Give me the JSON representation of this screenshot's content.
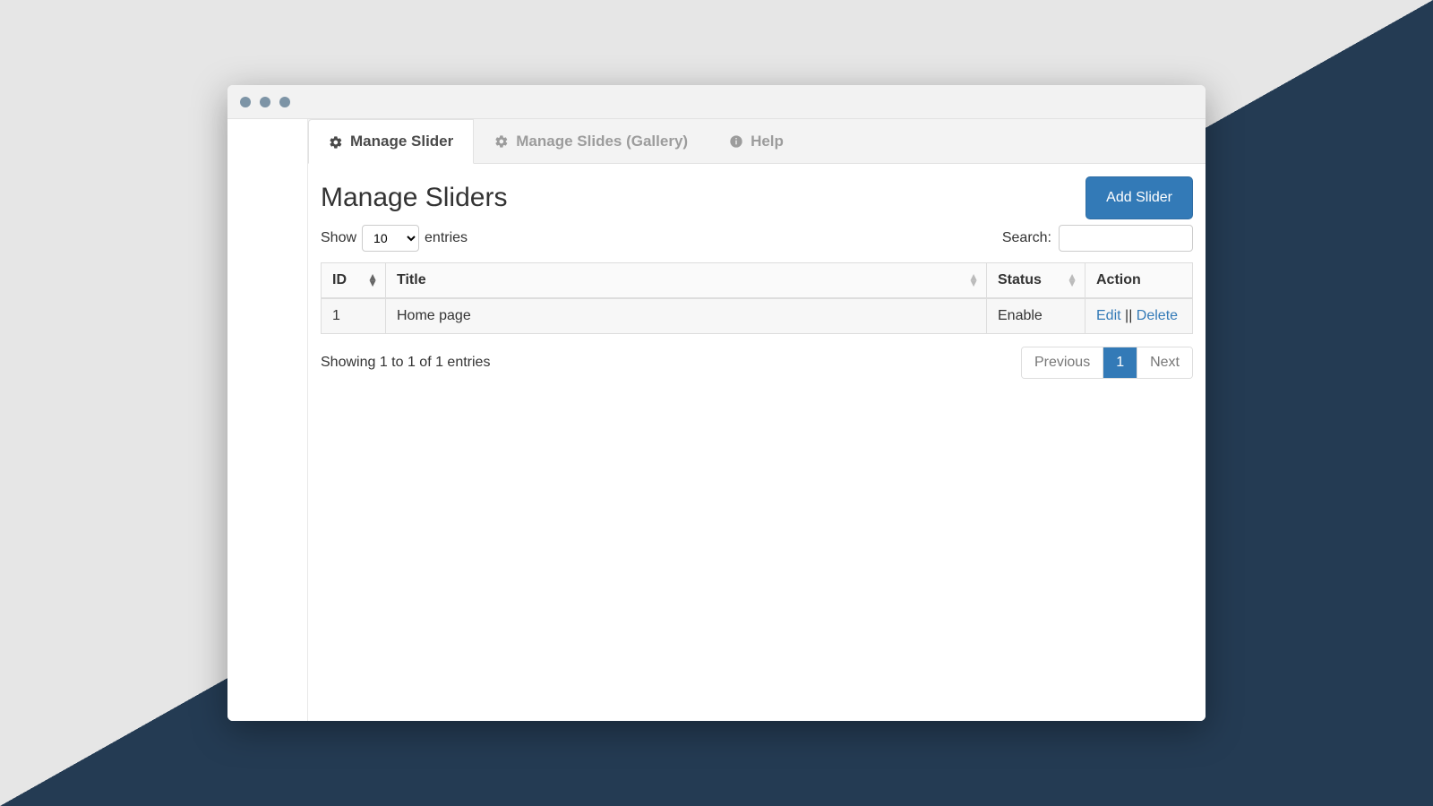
{
  "tabs": {
    "manage_slider": "Manage Slider",
    "manage_slides_gallery": "Manage Slides (Gallery)",
    "help": "Help"
  },
  "page": {
    "title": "Manage Sliders",
    "add_button": "Add Slider"
  },
  "length_menu": {
    "show_label": "Show",
    "entries_label": "entries",
    "selected": "10"
  },
  "search": {
    "label": "Search:",
    "value": ""
  },
  "table": {
    "columns": {
      "id": "ID",
      "title": "Title",
      "status": "Status",
      "action": "Action"
    },
    "rows": [
      {
        "id": "1",
        "title": "Home page",
        "status": "Enable"
      }
    ],
    "actions": {
      "edit": "Edit",
      "delete": "Delete",
      "separator": " || "
    }
  },
  "info_text": "Showing 1 to 1 of 1 entries",
  "pagination": {
    "previous": "Previous",
    "next": "Next",
    "current_page": "1"
  }
}
